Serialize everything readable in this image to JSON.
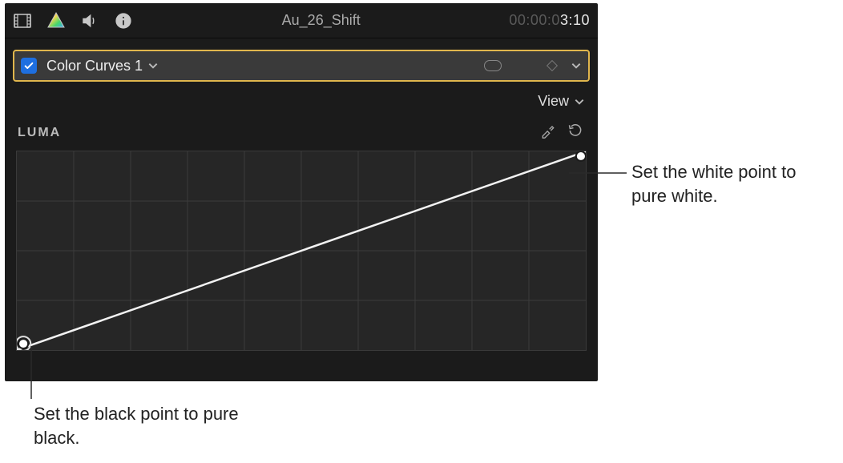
{
  "toolbar": {
    "clip_title": "Au_26_Shift",
    "timecode_gray": "00:00:0",
    "timecode_white": "3:10"
  },
  "effect": {
    "name": "Color Curves 1"
  },
  "view": {
    "label": "View"
  },
  "luma": {
    "title": "LUMA"
  },
  "callouts": {
    "white": "Set the white point to pure white.",
    "black": "Set the black point to pure black."
  },
  "chart_data": {
    "type": "line",
    "title": "LUMA",
    "xlabel": "",
    "ylabel": "",
    "x": [
      0,
      100
    ],
    "values": [
      0,
      100
    ],
    "xlim": [
      0,
      100
    ],
    "ylim": [
      0,
      100
    ],
    "points": [
      {
        "x": 0,
        "y": 0,
        "name": "black-point"
      },
      {
        "x": 100,
        "y": 100,
        "name": "white-point"
      }
    ],
    "grid": {
      "xdivs": 10,
      "ydivs": 4
    }
  }
}
